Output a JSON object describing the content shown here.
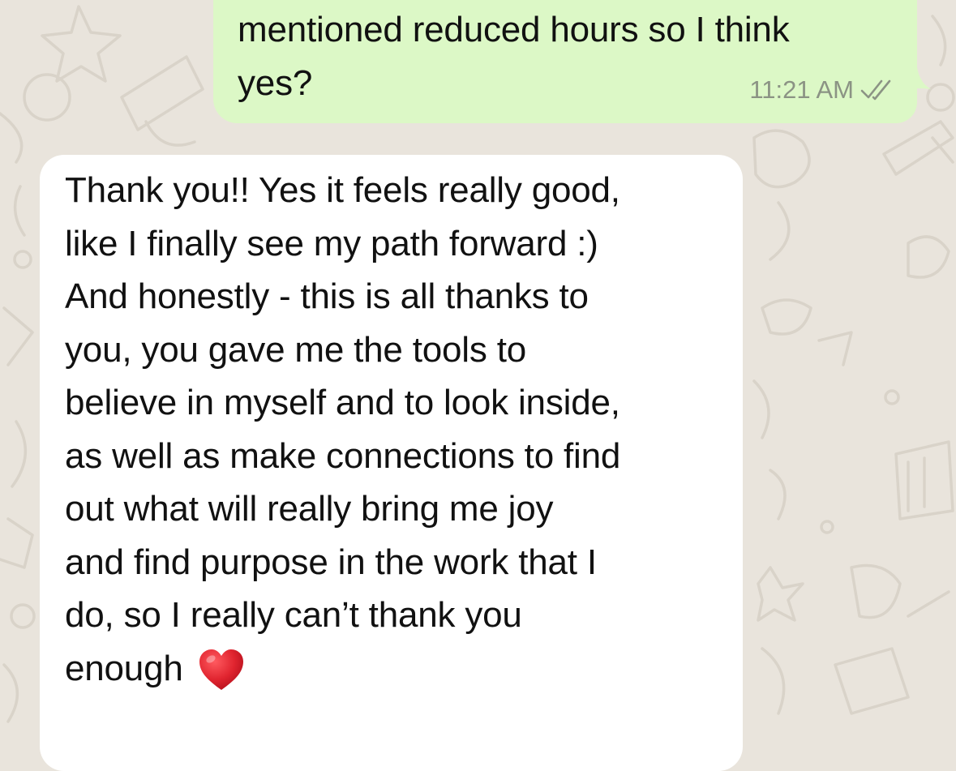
{
  "chat": {
    "colors": {
      "background": "#e9e4dc",
      "outgoing_bubble": "#dcf8c6",
      "incoming_bubble": "#ffffff",
      "text": "#111111",
      "meta_text": "#8b9384",
      "heart": "#d91e2e"
    },
    "outgoing": {
      "lines": [
        "mentioned reduced hours so I think",
        "yes?"
      ],
      "time": "11:21 AM",
      "status_icon": "double-check-icon"
    },
    "incoming": {
      "lines": [
        "Thank you!! Yes it feels really good,",
        "like I finally see my path forward :)",
        "And honestly - this is all thanks to",
        "you, you gave me the tools to",
        "believe in myself and to look inside,",
        "as well as make connections to find",
        "out what will really bring me joy",
        "and find purpose in the work that I",
        "do, so I really can’t thank you",
        "enough"
      ],
      "trailing_emoji": "red-heart-icon"
    }
  }
}
